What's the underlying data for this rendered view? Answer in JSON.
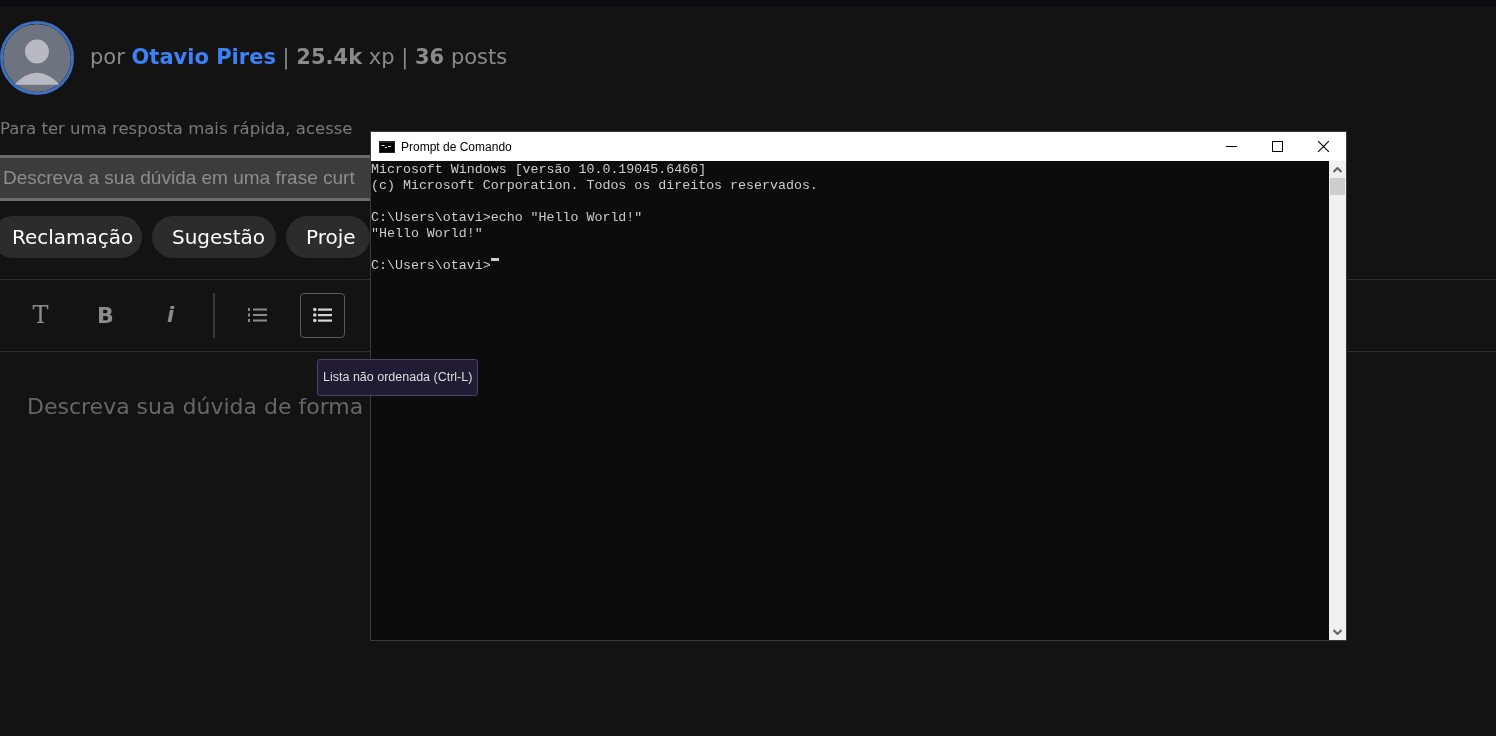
{
  "author": {
    "prefix": "por",
    "name": "Otavio Pires",
    "stats": "| **25.4k** xp | **36** posts"
  },
  "hint": "Para ter uma resposta mais rápida, acesse",
  "title_field": {
    "placeholder": "Descreva a sua dúvida em uma frase curt"
  },
  "categories": [
    "Reclamação",
    "Sugestão",
    "Proje"
  ],
  "toolbar": [
    {
      "kind": "heading",
      "label": "T",
      "active": false
    },
    {
      "kind": "bold",
      "label": "B",
      "active": false
    },
    {
      "kind": "italic",
      "label": "i",
      "active": false
    },
    {
      "kind": "separator"
    },
    {
      "kind": "ordered-list",
      "active": false
    },
    {
      "kind": "unordered-list",
      "active": true
    }
  ],
  "tooltip": "Lista não ordenada (Ctrl-L)",
  "editor": {
    "placeholder": "Descreva sua dúvida de forma"
  },
  "console_window": {
    "title": "Prompt de Comando",
    "blocks": [
      [
        "Microsoft Windows [versão 10.0.19045.6466]",
        "(c) Microsoft Corporation. Todos os direitos reservados."
      ],
      [
        "C:\\Users\\otavi>echo \"Hello World!\"",
        "\"Hello World!\""
      ],
      [
        "C:\\Users\\otavi>"
      ]
    ],
    "cursor": true
  }
}
